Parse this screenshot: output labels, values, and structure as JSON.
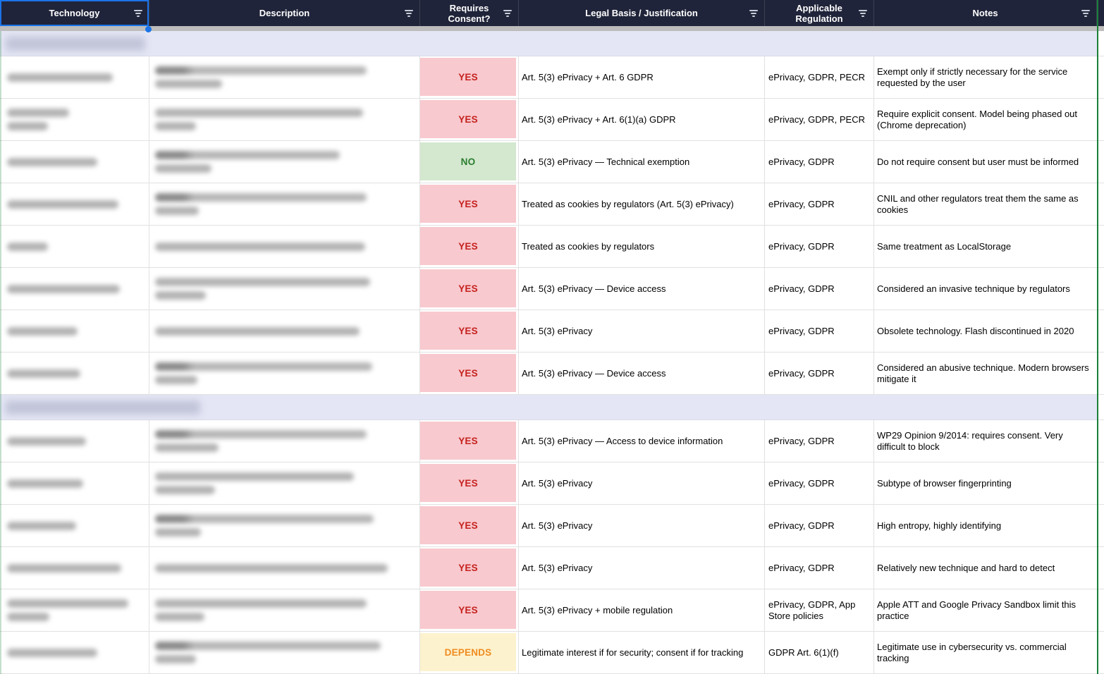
{
  "columns": [
    {
      "label": "Technology"
    },
    {
      "label": "Description"
    },
    {
      "label": "Requires Consent?"
    },
    {
      "label": "Legal Basis / Justification"
    },
    {
      "label": "Applicable Regulation"
    },
    {
      "label": "Notes"
    }
  ],
  "colors": {
    "header_bg": "#20243a",
    "header_text": "#ffffff",
    "selection_blue": "#1a73e8",
    "section_band_bg": "#e4e6f5",
    "frozen_divider": "#bcbcbc",
    "grid_line": "#e1e1e1",
    "range_border_green": "#188038",
    "consent_yes_bg": "#f8c9ce",
    "consent_yes_fg": "#c5221f",
    "consent_no_bg": "#d3e8cf",
    "consent_no_fg": "#2b7d2f",
    "consent_depends_bg": "#fdf2ce",
    "consent_depends_fg": "#ef8c20"
  },
  "consent_styles": {
    "YES": {
      "bg": "#f8c9ce",
      "fg": "#c5221f"
    },
    "NO": {
      "bg": "#d3e8cf",
      "fg": "#2b7d2f"
    },
    "DEPENDS": {
      "bg": "#fdf2ce",
      "fg": "#ef8c20"
    }
  },
  "sections": [
    {
      "before_row": 0,
      "redacted": true,
      "blur_width": 198
    },
    {
      "before_row": 8,
      "redacted": true,
      "blur_width": 276
    }
  ],
  "rows": [
    {
      "consent": "YES",
      "legal": "Art. 5(3) ePrivacy + Art. 6 GDPR",
      "regulation": "ePrivacy, GDPR, PECR",
      "notes": "Exempt only if strictly necessary for the service requested by the user",
      "tech_blur": [
        150
      ],
      "desc_blur": [
        300,
        95
      ],
      "desc_dark": true
    },
    {
      "consent": "YES",
      "legal": "Art. 5(3) ePrivacy + Art. 6(1)(a) GDPR",
      "regulation": "ePrivacy, GDPR, PECR",
      "notes": "Require explicit consent. Model being phased out (Chrome deprecation)",
      "tech_blur": [
        88,
        58
      ],
      "desc_blur": [
        295,
        58
      ],
      "desc_dark": false
    },
    {
      "consent": "NO",
      "legal": "Art. 5(3) ePrivacy — Technical exemption",
      "regulation": "ePrivacy, GDPR",
      "notes": "Do not require consent but user must be informed",
      "tech_blur": [
        128
      ],
      "desc_blur": [
        262,
        80
      ],
      "desc_dark": true
    },
    {
      "consent": "YES",
      "legal": "Treated as cookies by regulators (Art. 5(3) ePrivacy)",
      "regulation": "ePrivacy, GDPR",
      "notes": "CNIL and other regulators treat them the same as cookies",
      "tech_blur": [
        158
      ],
      "desc_blur": [
        300,
        62
      ],
      "desc_dark": true
    },
    {
      "consent": "YES",
      "legal": "Treated as cookies by regulators",
      "regulation": "ePrivacy, GDPR",
      "notes": "Same treatment as LocalStorage",
      "tech_blur": [
        58
      ],
      "desc_blur": [
        298
      ],
      "desc_dark": false
    },
    {
      "consent": "YES",
      "legal": "Art. 5(3) ePrivacy — Device access",
      "regulation": "ePrivacy, GDPR",
      "notes": "Considered an invasive technique by regulators",
      "tech_blur": [
        160
      ],
      "desc_blur": [
        305,
        72
      ],
      "desc_dark": false
    },
    {
      "consent": "YES",
      "legal": "Art. 5(3) ePrivacy",
      "regulation": "ePrivacy, GDPR",
      "notes": "Obsolete technology. Flash discontinued in 2020",
      "tech_blur": [
        100
      ],
      "desc_blur": [
        290
      ],
      "desc_dark": false
    },
    {
      "consent": "YES",
      "legal": "Art. 5(3) ePrivacy — Device access",
      "regulation": "ePrivacy, GDPR",
      "notes": "Considered an abusive technique. Modern browsers mitigate it",
      "tech_blur": [
        104
      ],
      "desc_blur": [
        308,
        60
      ],
      "desc_dark": true
    },
    {
      "consent": "YES",
      "legal": "Art. 5(3) ePrivacy — Access to device information",
      "regulation": "ePrivacy, GDPR",
      "notes": "WP29 Opinion 9/2014: requires consent. Very difficult to block",
      "tech_blur": [
        112
      ],
      "desc_blur": [
        300,
        90
      ],
      "desc_dark": true
    },
    {
      "consent": "YES",
      "legal": "Art. 5(3) ePrivacy",
      "regulation": "ePrivacy, GDPR",
      "notes": "Subtype of browser fingerprinting",
      "tech_blur": [
        108
      ],
      "desc_blur": [
        282,
        85
      ],
      "desc_dark": false
    },
    {
      "consent": "YES",
      "legal": "Art. 5(3) ePrivacy",
      "regulation": "ePrivacy, GDPR",
      "notes": "High entropy, highly identifying",
      "tech_blur": [
        98
      ],
      "desc_blur": [
        310,
        65
      ],
      "desc_dark": true
    },
    {
      "consent": "YES",
      "legal": "Art. 5(3) ePrivacy",
      "regulation": "ePrivacy, GDPR",
      "notes": "Relatively new technique and hard to detect",
      "tech_blur": [
        162
      ],
      "desc_blur": [
        330
      ],
      "desc_dark": false
    },
    {
      "consent": "YES",
      "legal": "Art. 5(3) ePrivacy + mobile regulation",
      "regulation": "ePrivacy, GDPR, App Store policies",
      "notes": "Apple ATT and Google Privacy Sandbox limit this practice",
      "tech_blur": [
        172,
        60
      ],
      "desc_blur": [
        300,
        70
      ],
      "desc_dark": false
    },
    {
      "consent": "DEPENDS",
      "legal": "Legitimate interest if for security; consent if for tracking",
      "regulation": "GDPR Art. 6(1)(f)",
      "notes": "Legitimate use in cybersecurity vs. commercial tracking",
      "tech_blur": [
        128
      ],
      "desc_blur": [
        320,
        58
      ],
      "desc_dark": true
    }
  ]
}
